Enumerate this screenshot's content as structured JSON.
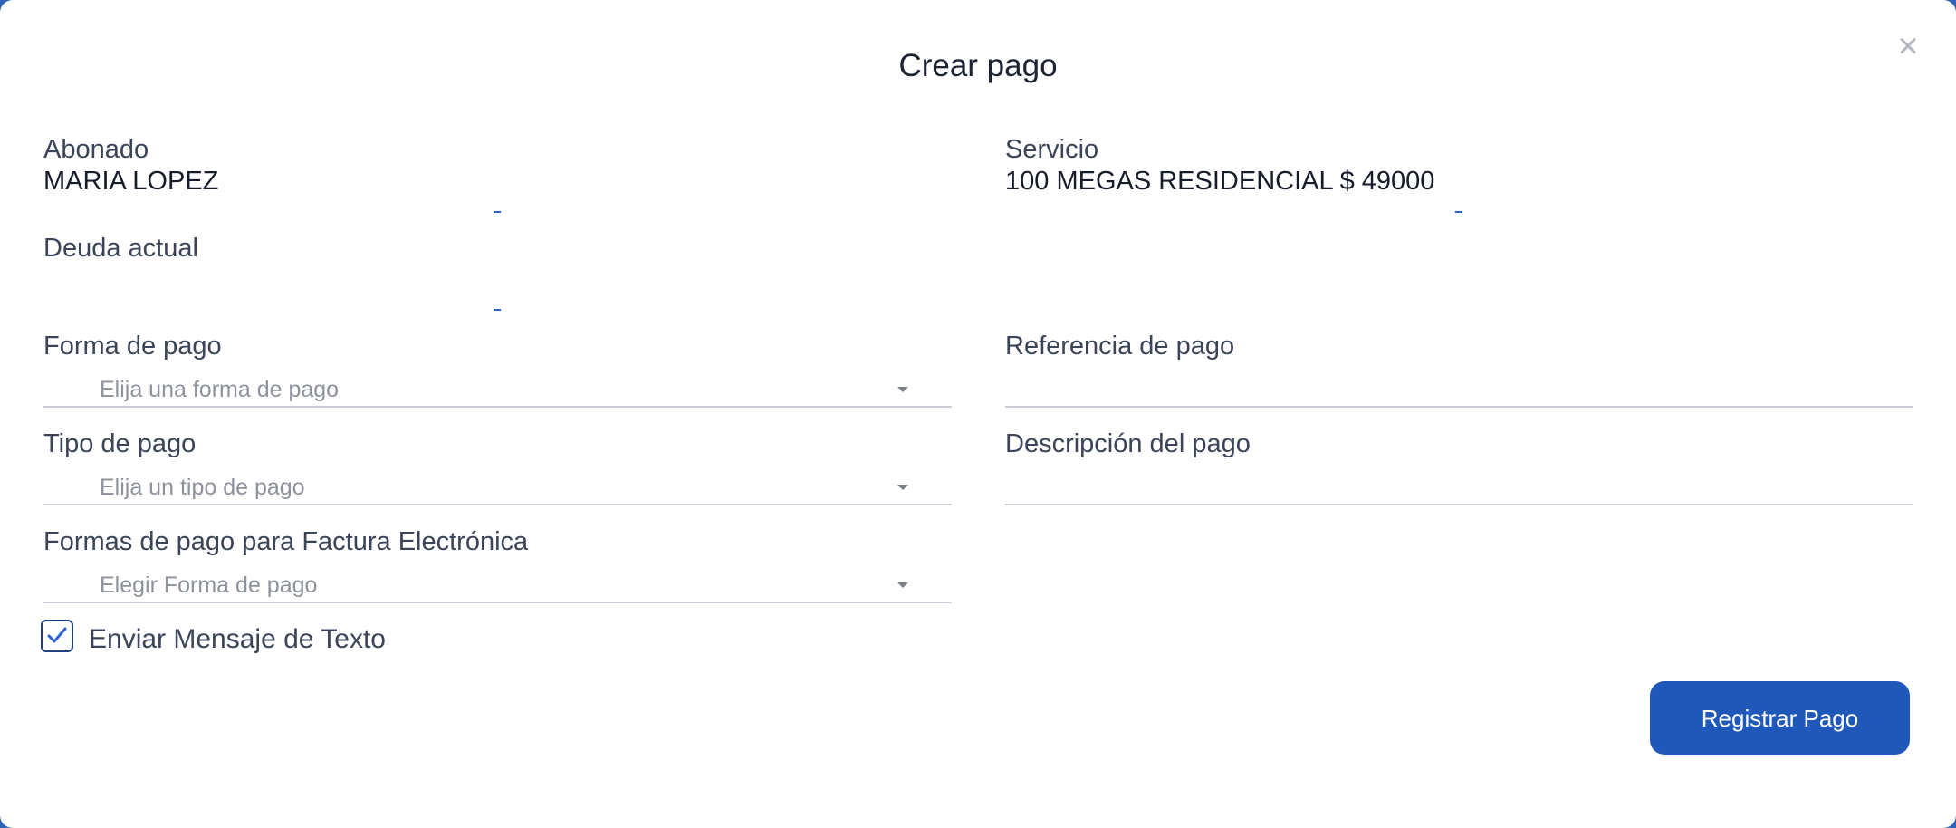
{
  "modal": {
    "title": "Crear pago",
    "close_glyph": "×"
  },
  "fields": {
    "abonado_label": "Abonado",
    "abonado_value": "MARIA LOPEZ",
    "servicio_label": "Servicio",
    "servicio_value": "100 MEGAS RESIDENCIAL  $ 49000",
    "deuda_label": "Deuda actual",
    "forma_pago_label": "Forma de pago",
    "forma_pago_placeholder": "Elija una forma de pago",
    "referencia_label": "Referencia de pago",
    "referencia_value": "",
    "tipo_pago_label": "Tipo de pago",
    "tipo_pago_placeholder": "Elija un tipo de pago",
    "descripcion_label": "Descripción del pago",
    "descripcion_value": "",
    "factura_label": "Formas de pago para Factura Electrónica",
    "factura_placeholder": "Elegir Forma de pago"
  },
  "sms": {
    "label": "Enviar Mensaje de Texto",
    "checked": true
  },
  "actions": {
    "submit_label": "Registrar Pago"
  },
  "colors": {
    "primary": "#1f58b8",
    "accent_dash": "#2b63d0",
    "text": "#3b4458",
    "placeholder": "#8d929b"
  },
  "icons": {
    "close": "close-icon",
    "caret": "chevron-down-icon",
    "check": "checkmark-icon"
  }
}
